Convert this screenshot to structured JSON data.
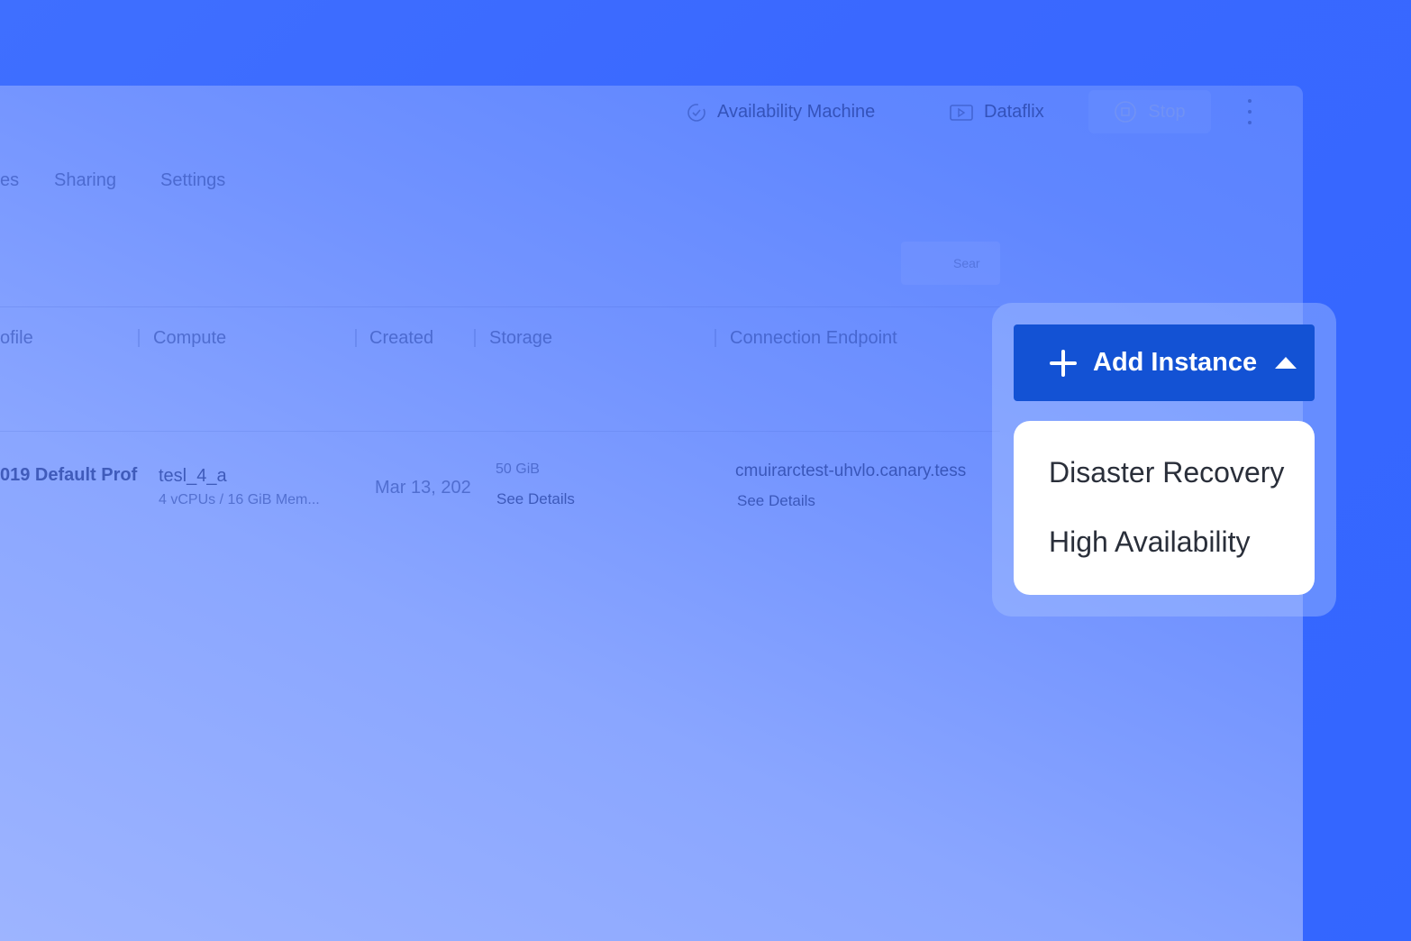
{
  "toolbar": {
    "availability_machine": "Availability Machine",
    "dataflix": "Dataflix",
    "stop": "Stop"
  },
  "tabs": [
    {
      "label": "es"
    },
    {
      "label": "Sharing"
    },
    {
      "label": "Settings"
    }
  ],
  "search": {
    "placeholder": "Sear"
  },
  "table": {
    "headers": [
      "ofile",
      "Compute",
      "Created",
      "Storage",
      "Connection Endpoint"
    ],
    "row": {
      "profile": "019 Default Prof",
      "compute_name": "tesl_4_a",
      "compute_spec": "4 vCPUs / 16 GiB Mem...",
      "created": "Mar 13, 202",
      "storage_size": "50 GiB",
      "storage_link": "See Details",
      "endpoint": "cmuirarctest-uhvlo.canary.tess",
      "endpoint_link": "See Details"
    }
  },
  "add_instance": {
    "label": "Add Instance",
    "menu": [
      "Disaster Recovery",
      "High Availability"
    ]
  },
  "colors": {
    "primary": "#1352d4",
    "background": "#3366ff"
  }
}
